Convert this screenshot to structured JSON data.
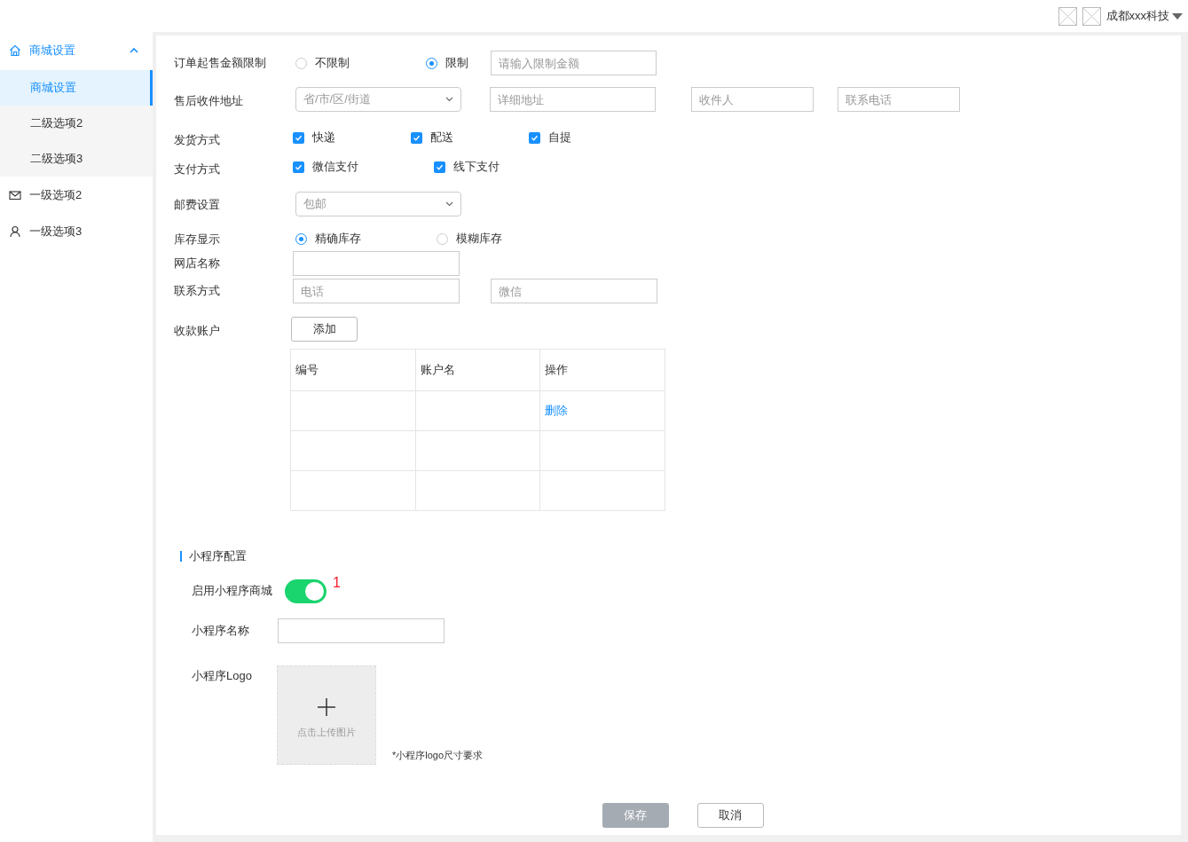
{
  "header": {
    "company": "成都xxx科技"
  },
  "sidebar": {
    "items": [
      {
        "label": "商城设置",
        "selected": true,
        "expanded": true,
        "children": [
          {
            "label": "商城设置",
            "selected": true
          },
          {
            "label": "二级选项2",
            "selected": false
          },
          {
            "label": "二级选项3",
            "selected": false
          }
        ]
      },
      {
        "label": "一级选项2",
        "selected": false
      },
      {
        "label": "一级选项3",
        "selected": false
      }
    ]
  },
  "form": {
    "min_order": {
      "label": "订单起售金额限制",
      "options": [
        {
          "label": "不限制",
          "selected": false
        },
        {
          "label": "限制",
          "selected": true
        }
      ],
      "placeholder": "请输入限制金额"
    },
    "address": {
      "label": "售后收件地址",
      "select_placeholder": "省/市/区/街道",
      "fields": [
        {
          "placeholder": "详细地址"
        },
        {
          "placeholder": "收件人"
        },
        {
          "placeholder": "联系电话"
        }
      ]
    },
    "delivery": {
      "label": "发货方式",
      "options": [
        {
          "label": "快递",
          "checked": true
        },
        {
          "label": "配送",
          "checked": true
        },
        {
          "label": "自提",
          "checked": true
        }
      ]
    },
    "payment": {
      "label": "支付方式",
      "options": [
        {
          "label": "微信支付",
          "checked": true
        },
        {
          "label": "线下支付",
          "checked": true
        }
      ]
    },
    "postage": {
      "label": "邮费设置",
      "value": "包邮"
    },
    "stock": {
      "label": "库存显示",
      "options": [
        {
          "label": "精确库存",
          "selected": true
        },
        {
          "label": "模糊库存",
          "selected": false
        }
      ]
    },
    "shop_name": {
      "label": "网店名称"
    },
    "contact": {
      "label": "联系方式",
      "fields": [
        {
          "placeholder": "电话"
        },
        {
          "placeholder": "微信"
        }
      ]
    },
    "accounts": {
      "label": "收款账户",
      "add_button": "添加",
      "columns": [
        "编号",
        "账户名",
        "操作"
      ],
      "rows": [
        {
          "action": "删除"
        },
        {},
        {}
      ]
    }
  },
  "mini": {
    "title": "小程序配置",
    "enable": {
      "label": "启用小程序商城",
      "on": true,
      "badge": "1"
    },
    "name": {
      "label": "小程序名称"
    },
    "logo": {
      "label": "小程序Logo",
      "upload_text": "点击上传图片",
      "note": "*小程序logo尺寸要求"
    }
  },
  "buttons": [
    {
      "label": "保存",
      "disabled": true
    },
    {
      "label": "取消",
      "disabled": false
    }
  ]
}
